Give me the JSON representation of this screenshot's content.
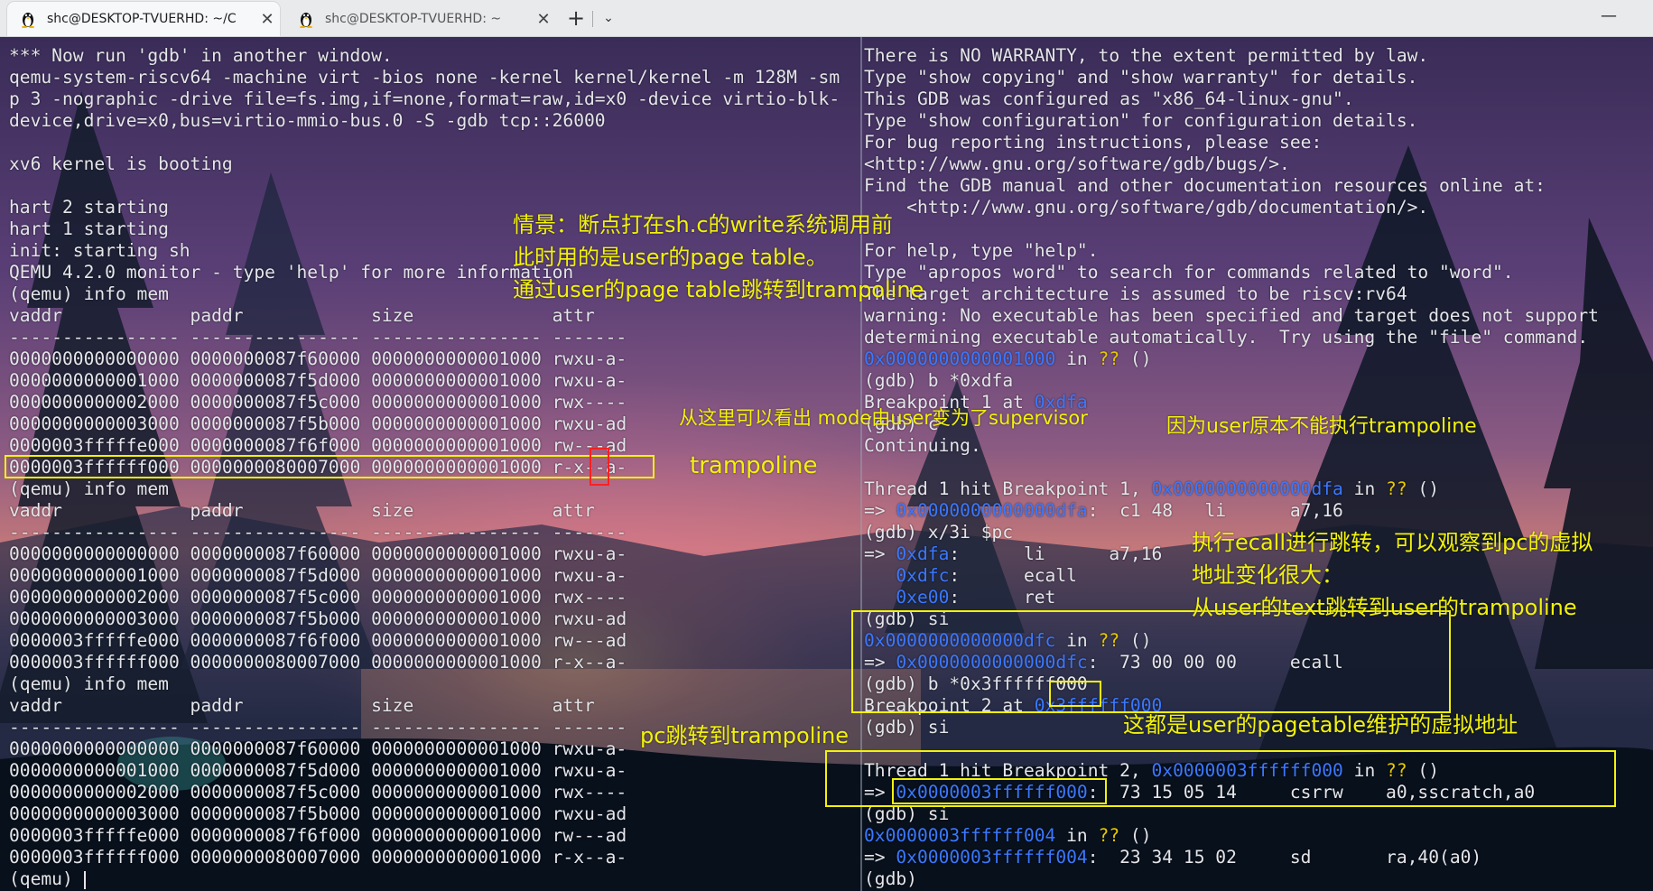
{
  "tabs": [
    {
      "title": "shc@DESKTOP-TVUERHD: ~/C"
    },
    {
      "title": "shc@DESKTOP-TVUERHD: ~"
    }
  ],
  "new_tab_label": "+",
  "dropdown_label": "⌄",
  "minimize_label": "—",
  "left_pane": [
    "*** Now run 'gdb' in another window.",
    "qemu-system-riscv64 -machine virt -bios none -kernel kernel/kernel -m 128M -sm",
    "p 3 -nographic -drive file=fs.img,if=none,format=raw,id=x0 -device virtio-blk-",
    "device,drive=x0,bus=virtio-mmio-bus.0 -S -gdb tcp::26000",
    "",
    "xv6 kernel is booting",
    "",
    "hart 2 starting",
    "hart 1 starting",
    "init: starting sh",
    "QEMU 4.2.0 monitor - type 'help' for more information",
    "(qemu) info mem",
    "vaddr            paddr            size             attr",
    "---------------- ---------------- ---------------- -------",
    "0000000000000000 0000000087f60000 0000000000001000 rwxu-a-",
    "0000000000001000 0000000087f5d000 0000000000001000 rwxu-a-",
    "0000000000002000 0000000087f5c000 0000000000001000 rwx----",
    "0000000000003000 0000000087f5b000 0000000000001000 rwxu-ad",
    "0000003fffffe000 0000000087f6f000 0000000000001000 rw---ad",
    "0000003ffffff000 0000000080007000 0000000000001000 r-x--a-",
    "(qemu) info mem",
    "vaddr            paddr            size             attr",
    "---------------- ---------------- ---------------- -------",
    "0000000000000000 0000000087f60000 0000000000001000 rwxu-a-",
    "0000000000001000 0000000087f5d000 0000000000001000 rwxu-a-",
    "0000000000002000 0000000087f5c000 0000000000001000 rwx----",
    "0000000000003000 0000000087f5b000 0000000000001000 rwxu-ad",
    "0000003fffffe000 0000000087f6f000 0000000000001000 rw---ad",
    "0000003ffffff000 0000000080007000 0000000000001000 r-x--a-",
    "(qemu) info mem",
    "vaddr            paddr            size             attr",
    "---------------- ---------------- ---------------- -------",
    "0000000000000000 0000000087f60000 0000000000001000 rwxu-a-",
    "0000000000001000 0000000087f5d000 0000000000001000 rwxu-a-",
    "0000000000002000 0000000087f5c000 0000000000001000 rwx----",
    "0000000000003000 0000000087f5b000 0000000000001000 rwxu-ad",
    "0000003fffffe000 0000000087f6f000 0000000000001000 rw---ad",
    "0000003ffffff000 0000000080007000 0000000000001000 r-x--a-",
    "(qemu) "
  ],
  "right_pane": [
    [
      {
        "t": "There is NO WARRANTY, to the extent permitted by law."
      }
    ],
    [
      {
        "t": "Type \"show copying\" and \"show warranty\" for details."
      }
    ],
    [
      {
        "t": "This GDB was configured as \"x86_64-linux-gnu\"."
      }
    ],
    [
      {
        "t": "Type \"show configuration\" for configuration details."
      }
    ],
    [
      {
        "t": "For bug reporting instructions, please see:"
      }
    ],
    [
      {
        "t": "<http://www.gnu.org/software/gdb/bugs/>."
      }
    ],
    [
      {
        "t": "Find the GDB manual and other documentation resources online at:"
      }
    ],
    [
      {
        "t": "    <http://www.gnu.org/software/gdb/documentation/>."
      }
    ],
    [
      {
        "t": ""
      }
    ],
    [
      {
        "t": "For help, type \"help\"."
      }
    ],
    [
      {
        "t": "Type \"apropos word\" to search for commands related to \"word\"."
      }
    ],
    [
      {
        "t": "The target architecture is assumed to be riscv:rv64"
      }
    ],
    [
      {
        "t": "warning: No executable has been specified and target does not support"
      }
    ],
    [
      {
        "t": "determining executable automatically.  Try using the \"file\" command."
      }
    ],
    [
      {
        "t": "0x0000000000001000",
        "c": "blue"
      },
      {
        "t": " in "
      },
      {
        "t": "??",
        "c": "yel"
      },
      {
        "t": " ()"
      }
    ],
    [
      {
        "t": "(gdb) b *0xdfa"
      }
    ],
    [
      {
        "t": "Breakpoint 1 at "
      },
      {
        "t": "0xdfa",
        "c": "blue"
      }
    ],
    [
      {
        "t": "(gdb) c"
      }
    ],
    [
      {
        "t": "Continuing."
      }
    ],
    [
      {
        "t": ""
      }
    ],
    [
      {
        "t": "Thread 1 hit Breakpoint 1, "
      },
      {
        "t": "0x0000000000000dfa",
        "c": "blue"
      },
      {
        "t": " in "
      },
      {
        "t": "??",
        "c": "yel"
      },
      {
        "t": " ()"
      }
    ],
    [
      {
        "t": "=> "
      },
      {
        "t": "0x0000000000000dfa",
        "c": "blue"
      },
      {
        "t": ":  c1 48   li      a7,16"
      }
    ],
    [
      {
        "t": "(gdb) x/3i $pc"
      }
    ],
    [
      {
        "t": "=> "
      },
      {
        "t": "0xdfa",
        "c": "blue"
      },
      {
        "t": ":      li      a7,16"
      }
    ],
    [
      {
        "t": "   "
      },
      {
        "t": "0xdfc",
        "c": "blue"
      },
      {
        "t": ":      ecall"
      }
    ],
    [
      {
        "t": "   "
      },
      {
        "t": "0xe00",
        "c": "blue"
      },
      {
        "t": ":      ret"
      }
    ],
    [
      {
        "t": "(gdb) si"
      }
    ],
    [
      {
        "t": "0x0000000000000dfc",
        "c": "blue"
      },
      {
        "t": " in "
      },
      {
        "t": "??",
        "c": "yel"
      },
      {
        "t": " ()"
      }
    ],
    [
      {
        "t": "=> "
      },
      {
        "t": "0x0000000000000dfc",
        "c": "blue"
      },
      {
        "t": ":  73 00 00 00     ecall"
      }
    ],
    [
      {
        "t": "(gdb) b *0x3ffffff000"
      }
    ],
    [
      {
        "t": "Breakpoint 2 at "
      },
      {
        "t": "0x3ffffff000",
        "c": "blue"
      }
    ],
    [
      {
        "t": "(gdb) si"
      }
    ],
    [
      {
        "t": ""
      }
    ],
    [
      {
        "t": "Thread 1 hit Breakpoint 2, "
      },
      {
        "t": "0x0000003ffffff000",
        "c": "blue"
      },
      {
        "t": " in "
      },
      {
        "t": "??",
        "c": "yel"
      },
      {
        "t": " ()"
      }
    ],
    [
      {
        "t": "=> "
      },
      {
        "t": "0x0000003ffffff000",
        "c": "blue"
      },
      {
        "t": ":  73 15 05 14     csrrw    a0,sscratch,a0"
      }
    ],
    [
      {
        "t": "(gdb) si"
      }
    ],
    [
      {
        "t": "0x0000003ffffff004",
        "c": "blue"
      },
      {
        "t": " in "
      },
      {
        "t": "??",
        "c": "yel"
      },
      {
        "t": " ()"
      }
    ],
    [
      {
        "t": "=> "
      },
      {
        "t": "0x0000003ffffff004",
        "c": "blue"
      },
      {
        "t": ":  23 34 15 02     sd       ra,40(a0)"
      }
    ],
    [
      {
        "t": "(gdb) "
      }
    ]
  ],
  "annotations": {
    "scenario_1": "情景：断点打在sh.c的write系统调用前",
    "scenario_2": "此时用的是user的page table。",
    "scenario_3": "通过user的page table跳转到trampoline",
    "mode_change": "从这里可以看出 mode由user变为了supervisor",
    "trampoline": "trampoline",
    "user_cannot": "因为user原本不能执行trampoline",
    "ecall_1": "执行ecall进行跳转，可以观察到pc的虚拟",
    "ecall_2": "地址变化很大：",
    "ecall_3": "从user的text跳转到user的trampoline",
    "pagetable_note": "这都是user的pagetable维护的虚拟地址",
    "pc_jump": "pc跳转到trampoline"
  }
}
